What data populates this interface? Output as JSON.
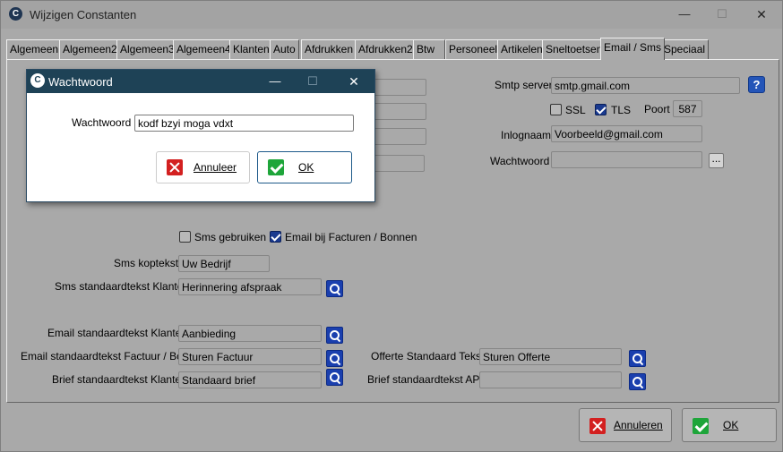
{
  "window": {
    "title": "Wijzigen Constanten",
    "min": "—",
    "max": "☐",
    "close": "✕"
  },
  "tabs": [
    "Algemeen",
    "Algemeen2",
    "Algemeen3",
    "Algemeen4",
    "Klanten",
    "Auto",
    "Afdrukken",
    "Afdrukken2",
    "Btw",
    "Personeel",
    "Artikelen",
    "Sneltoetsen",
    "Email / Sms",
    "Speciaal"
  ],
  "active_tab": "Email / Sms",
  "smtp": {
    "server_label": "Smtp server",
    "server_value": "smtp.gmail.com",
    "help": "?",
    "ssl_label": "SSL",
    "ssl_checked": false,
    "tls_label": "TLS",
    "tls_checked": true,
    "poort_label": "Poort",
    "poort_value": "587",
    "inlog_label": "Inlognaam",
    "inlog_value": "Voorbeeld@gmail.com",
    "pw_label": "Wachtwoord",
    "pw_value": "",
    "pw_button": "..."
  },
  "options": {
    "sms_label": "Sms gebruiken",
    "sms_checked": false,
    "email_label": "Email bij Facturen / Bonnen",
    "email_checked": true
  },
  "fields": {
    "sms_koptekst_label": "Sms koptekst",
    "sms_koptekst_value": "Uw Bedrijf",
    "sms_std_label": "Sms standaardtekst Klanten",
    "sms_std_value": "Herinnering afspraak",
    "email_std_label": "Email standaardtekst Klanten",
    "email_std_value": "Aanbieding",
    "email_factuur_label": "Email standaardtekst Factuur / Bon",
    "email_factuur_value": "Sturen Factuur",
    "brief_label": "Brief standaardtekst Klanten",
    "brief_value": "Standaard brief",
    "offerte_label": "Offerte Standaard Tekst",
    "offerte_value": "Sturen Offerte",
    "brief_apk_label": "Brief standaardtekst APK",
    "brief_apk_value": ""
  },
  "footer": {
    "cancel_label": "Annuleren",
    "ok_label": "OK"
  },
  "dialog": {
    "title": "Wachtwoord",
    "min": "—",
    "max": "☐",
    "close": "✕",
    "field_label": "Wachtwoord",
    "field_value": "kodf bzyi moga vdxt",
    "cancel_label": "Annuleer",
    "ok_label": "OK"
  },
  "colors": {
    "dialog_title": "#1e4256",
    "search_button": "#1a3fae",
    "cancel_icon": "#d32020",
    "ok_icon": "#1ea53a"
  }
}
